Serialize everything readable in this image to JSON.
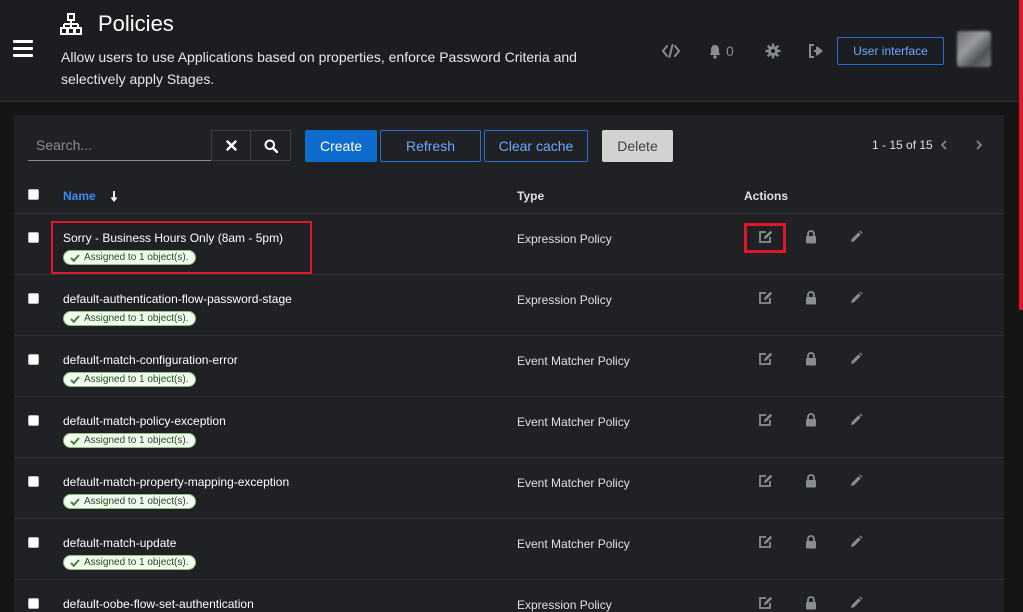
{
  "header": {
    "title": "Policies",
    "description": "Allow users to use Applications based on properties, enforce Password Criteria and selectively apply Stages.",
    "notification_count": "0",
    "user_interface_label": "User interface"
  },
  "toolbar": {
    "search_placeholder": "Search...",
    "create_label": "Create",
    "refresh_label": "Refresh",
    "clear_cache_label": "Clear cache",
    "delete_label": "Delete",
    "pagination_text": "1 - 15 of 15"
  },
  "table": {
    "columns": {
      "name": "Name",
      "type": "Type",
      "actions": "Actions"
    },
    "rows": [
      {
        "name": "Sorry - Business Hours Only (8am - 5pm)",
        "badge": "Assigned to 1 object(s).",
        "type": "Expression Policy"
      },
      {
        "name": "default-authentication-flow-password-stage",
        "badge": "Assigned to 1 object(s).",
        "type": "Expression Policy"
      },
      {
        "name": "default-match-configuration-error",
        "badge": "Assigned to 1 object(s).",
        "type": "Event Matcher Policy"
      },
      {
        "name": "default-match-policy-exception",
        "badge": "Assigned to 1 object(s).",
        "type": "Event Matcher Policy"
      },
      {
        "name": "default-match-property-mapping-exception",
        "badge": "Assigned to 1 object(s).",
        "type": "Event Matcher Policy"
      },
      {
        "name": "default-match-update",
        "badge": "Assigned to 1 object(s).",
        "type": "Event Matcher Policy"
      },
      {
        "name": "default-oobe-flow-set-authentication",
        "badge": "",
        "type": "Expression Policy"
      }
    ]
  },
  "colors": {
    "accent": "#0f6ccf",
    "link": "#3a8bf0",
    "highlight": "#e0162b",
    "badge_border": "#8cc37a",
    "background": "#151515",
    "panel": "#1f2124"
  },
  "icons": {
    "title": "sitemap-icon",
    "menu": "hamburger-icon",
    "api": "code-icon",
    "notifications": "bell-icon",
    "settings": "gear-icon",
    "logout": "sign-out-icon",
    "clear": "close-icon",
    "search": "search-icon",
    "edit": "edit-icon",
    "permissions": "lock-icon",
    "test": "pencil-icon"
  }
}
